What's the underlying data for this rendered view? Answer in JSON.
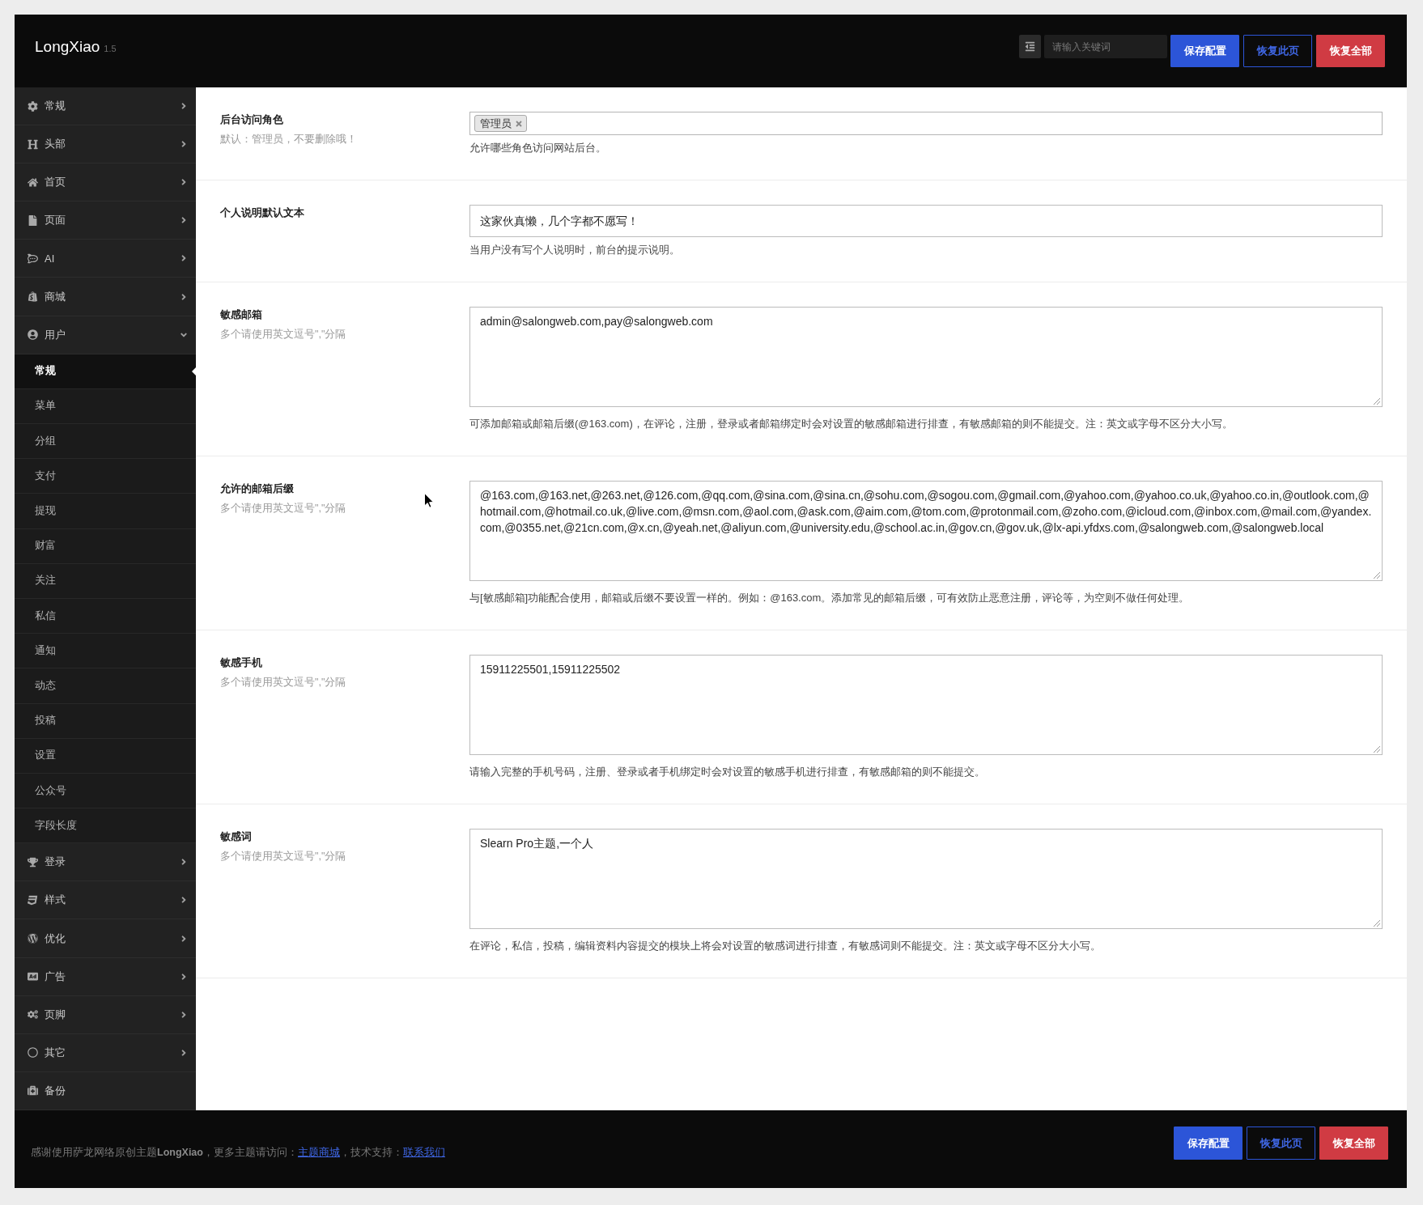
{
  "header": {
    "logo": "LongXiao",
    "version": "1.5",
    "search": {
      "placeholder": "请输入关键词"
    },
    "buttons": [
      {
        "label": "保存配置",
        "kind": "primary"
      },
      {
        "label": "恢复此页",
        "kind": "outline"
      },
      {
        "label": "恢复全部",
        "kind": "danger"
      }
    ]
  },
  "sidebar": {
    "items": [
      {
        "label": "常规",
        "kind": "menu",
        "expanded": false
      },
      {
        "label": "头部",
        "kind": "menu",
        "expanded": false
      },
      {
        "label": "首页",
        "kind": "menu",
        "expanded": false
      },
      {
        "label": "页面",
        "kind": "menu",
        "expanded": false
      },
      {
        "label": "AI",
        "kind": "menu",
        "expanded": false
      },
      {
        "label": "商城",
        "kind": "menu",
        "expanded": false
      },
      {
        "label": "用户",
        "kind": "menu",
        "expanded": true,
        "children": [
          {
            "label": "常规",
            "selected": true
          },
          {
            "label": "菜单",
            "selected": false
          },
          {
            "label": "分组",
            "selected": false
          },
          {
            "label": "支付",
            "selected": false
          },
          {
            "label": "提现",
            "selected": false
          },
          {
            "label": "财富",
            "selected": false
          },
          {
            "label": "关注",
            "selected": false
          },
          {
            "label": "私信",
            "selected": false
          },
          {
            "label": "通知",
            "selected": false
          },
          {
            "label": "动态",
            "selected": false
          },
          {
            "label": "投稿",
            "selected": false
          },
          {
            "label": "设置",
            "selected": false
          },
          {
            "label": "公众号",
            "selected": false
          },
          {
            "label": "字段长度",
            "selected": false
          }
        ]
      },
      {
        "label": "登录",
        "kind": "menu",
        "expanded": false
      },
      {
        "label": "样式",
        "kind": "menu",
        "expanded": false
      },
      {
        "label": "优化",
        "kind": "menu",
        "expanded": false
      },
      {
        "label": "广告",
        "kind": "menu",
        "expanded": false
      },
      {
        "label": "页脚",
        "kind": "menu",
        "expanded": false
      },
      {
        "label": "其它",
        "kind": "menu",
        "expanded": false
      },
      {
        "label": "备份",
        "kind": "link"
      }
    ]
  },
  "settings": [
    {
      "label": "后台访问角色",
      "note": "默认：管理员，不要删除哦！",
      "kind": "tags",
      "tags": [
        "管理员"
      ],
      "help": "允许哪些角色访问网站后台。"
    },
    {
      "label": "个人说明默认文本",
      "kind": "text",
      "value": "这家伙真懒，几个字都不愿写！",
      "help": "当用户没有写个人说明时，前台的提示说明。"
    },
    {
      "label": "敏感邮箱",
      "note": "多个请使用英文逗号\",\"分隔",
      "kind": "textarea",
      "value": "admin@salongweb.com,pay@salongweb.com",
      "help": "可添加邮箱或邮箱后缀(@163.com)，在评论，注册，登录或者邮箱绑定时会对设置的敏感邮箱进行排查，有敏感邮箱的则不能提交。注：英文或字母不区分大小写。"
    },
    {
      "label": "允许的邮箱后缀",
      "note": "多个请使用英文逗号\",\"分隔",
      "kind": "textarea",
      "value": "@163.com,@163.net,@263.net,@126.com,@qq.com,@sina.com,@sina.cn,@sohu.com,@sogou.com,@gmail.com,@yahoo.com,@yahoo.co.uk,@yahoo.co.in,@outlook.com,@hotmail.com,@hotmail.co.uk,@live.com,@msn.com,@aol.com,@ask.com,@aim.com,@tom.com,@protonmail.com,@zoho.com,@icloud.com,@inbox.com,@mail.com,@yandex.com,@0355.net,@21cn.com,@x.cn,@yeah.net,@aliyun.com,@university.edu,@school.ac.in,@gov.cn,@gov.uk,@lx-api.yfdxs.com,@salongweb.com,@salongweb.local",
      "help": "与[敏感邮箱]功能配合使用，邮箱或后缀不要设置一样的。例如：@163.com。添加常见的邮箱后缀，可有效防止恶意注册，评论等，为空则不做任何处理。"
    },
    {
      "label": "敏感手机",
      "note": "多个请使用英文逗号\",\"分隔",
      "kind": "textarea",
      "value": "15911225501,15911225502",
      "help": "请输入完整的手机号码，注册、登录或者手机绑定时会对设置的敏感手机进行排查，有敏感邮箱的则不能提交。"
    },
    {
      "label": "敏感词",
      "note": "多个请使用英文逗号\",\"分隔",
      "kind": "textarea",
      "value": "Slearn Pro主题,一个人",
      "help": "在评论，私信，投稿，编辑资料内容提交的模块上将会对设置的敏感词进行排查，有敏感词则不能提交。注：英文或字母不区分大小写。"
    }
  ],
  "footer": {
    "credit": [
      {
        "kind": "text",
        "text": "感谢使用萨龙网络原创主题**LongXiao**，更多主题请访问："
      },
      {
        "kind": "link",
        "text": "主题商城"
      },
      {
        "kind": "text",
        "text": "，技术支持："
      },
      {
        "kind": "link",
        "text": "联系我们"
      }
    ],
    "buttons": [
      {
        "label": "保存配置",
        "kind": "primary"
      },
      {
        "label": "恢复此页",
        "kind": "outline"
      },
      {
        "label": "恢复全部",
        "kind": "danger"
      }
    ]
  }
}
